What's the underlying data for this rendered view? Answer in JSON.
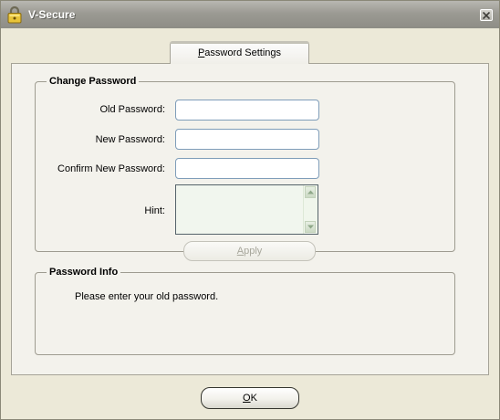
{
  "window": {
    "title": "V-Secure"
  },
  "tabs": [
    {
      "label": "Password Settings",
      "mnemonic": "P",
      "rest": "assword Settings"
    }
  ],
  "change_password": {
    "legend": "Change Password",
    "old_label": "Old Password:",
    "new_label": "New Password:",
    "confirm_label": "Confirm New Password:",
    "hint_label": "Hint:",
    "old_value": "",
    "new_value": "",
    "confirm_value": "",
    "hint_value": "",
    "apply": {
      "label": "Apply",
      "mnemonic": "A",
      "rest": "pply",
      "enabled": false
    }
  },
  "password_info": {
    "legend": "Password Info",
    "message": "Please enter your old password."
  },
  "ok_button": {
    "label": "OK",
    "mnemonic": "O",
    "rest": "K"
  },
  "icons": {
    "app": "padlock-icon",
    "close": "close-icon",
    "scroll_up": "scroll-up-icon",
    "scroll_down": "scroll-down-icon"
  },
  "colors": {
    "titlebar": "#9B9A93",
    "background": "#ECE9D8",
    "field_border": "#7F9DB9"
  }
}
